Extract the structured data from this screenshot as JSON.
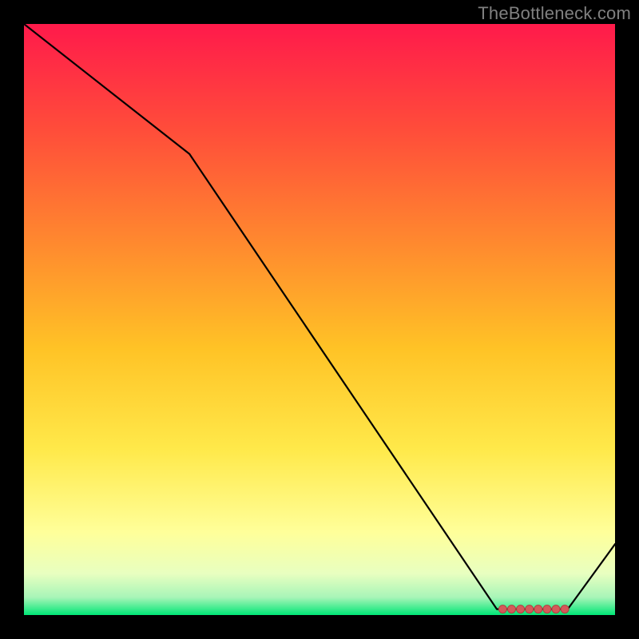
{
  "attribution": "TheBottleneck.com",
  "colors": {
    "background_frame": "#000000",
    "gradient_top": "#ff1744",
    "gradient_mid_upper": "#ff7a2d",
    "gradient_mid": "#ffd21f",
    "gradient_lower": "#ffff8a",
    "gradient_near_bottom": "#d8ffb0",
    "gradient_bottom": "#00e676",
    "curve": "#000000",
    "marker": "#d45a5a"
  },
  "chart_data": {
    "type": "line",
    "title": "",
    "xlabel": "",
    "ylabel": "",
    "xlim": [
      0,
      100
    ],
    "ylim": [
      0,
      100
    ],
    "x": [
      0,
      28,
      80,
      92,
      100
    ],
    "y": [
      100,
      78,
      1,
      1,
      12
    ],
    "markers": {
      "x": [
        81,
        82.5,
        84,
        85.5,
        87,
        88.5,
        90,
        91.5
      ],
      "y": [
        1,
        1,
        1,
        1,
        1,
        1,
        1,
        1
      ]
    },
    "annotations": []
  }
}
